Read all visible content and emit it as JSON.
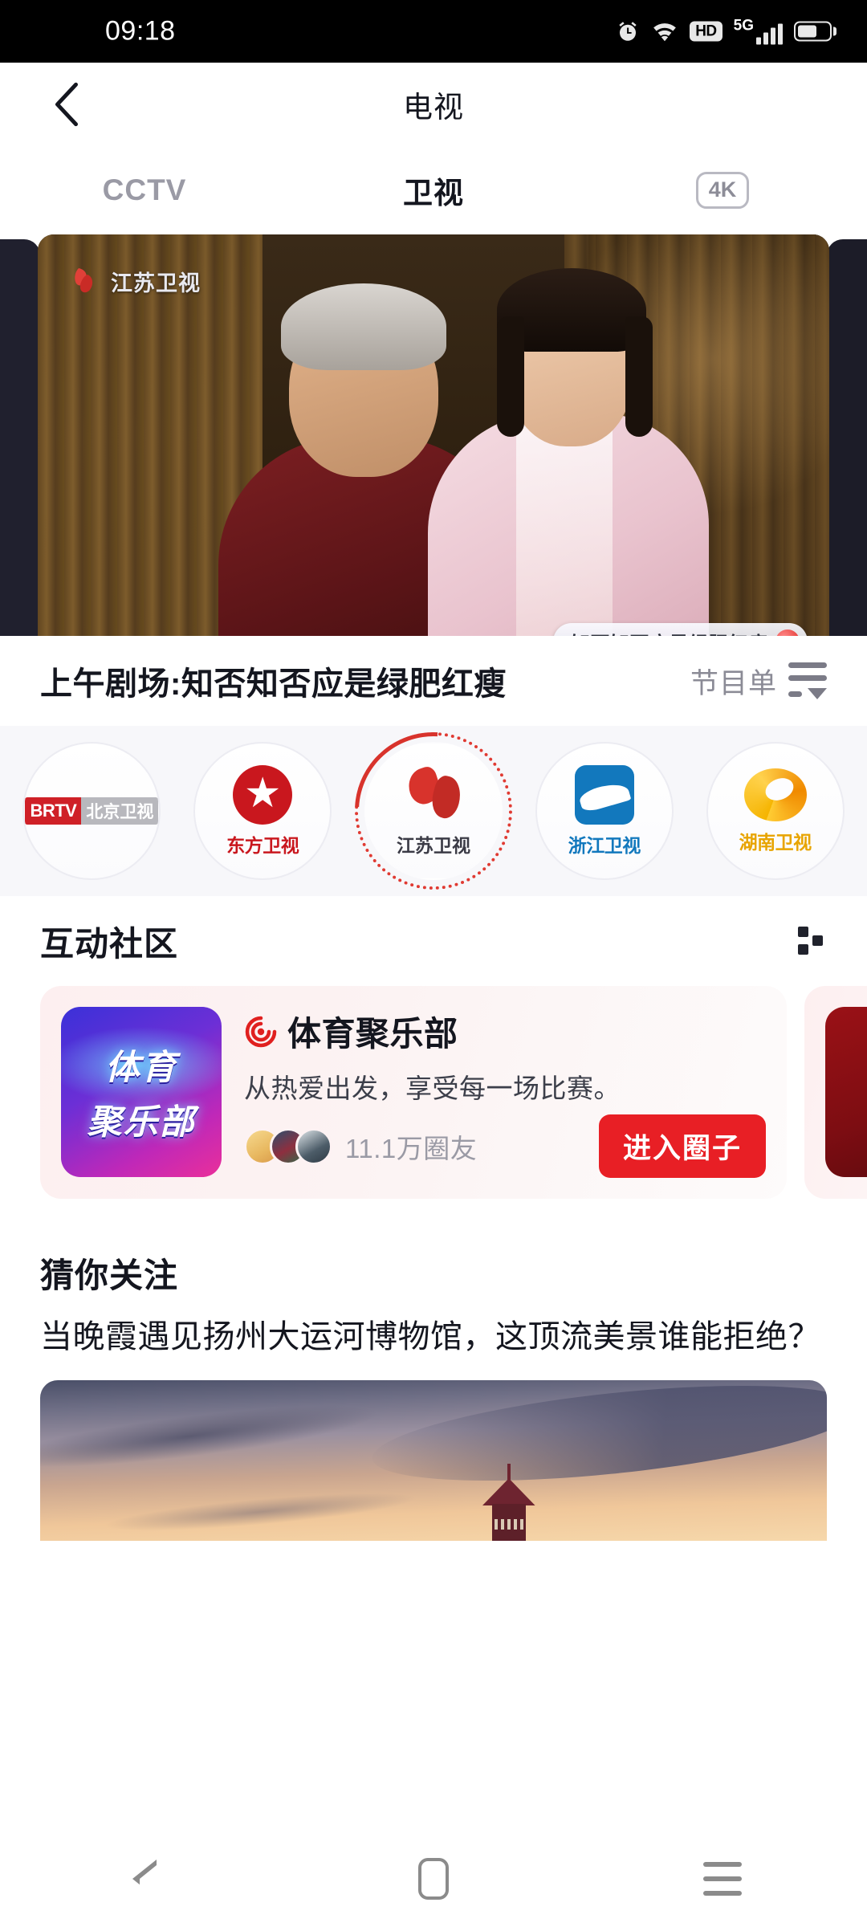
{
  "status_bar": {
    "time": "09:18",
    "icons": [
      "alarm-icon",
      "wifi-icon",
      "hd-icon",
      "5g-icon",
      "signal-icon",
      "battery-icon"
    ],
    "hd_label": "HD",
    "network_label": "5G"
  },
  "app_bar": {
    "back_icon": "chevron-left-icon",
    "title": "电视"
  },
  "tabs": [
    {
      "label": "CCTV",
      "active": false
    },
    {
      "label": "卫视",
      "active": true
    },
    {
      "label": "4K",
      "active": false,
      "badge": true
    }
  ],
  "player": {
    "watermark_text": "江苏卫视",
    "watermark_icon": "jiangsu-tv-logo",
    "badge_label": "知否知否应是绿肥红瘦"
  },
  "program": {
    "title": "上午剧场:知否知否应是绿肥红瘦",
    "list_label": "节目单",
    "list_icon": "program-list-icon"
  },
  "channels": [
    {
      "name": "北京卫视",
      "short": "BRTV",
      "sub": "北京卫视",
      "selected": false
    },
    {
      "name": "东方卫视",
      "selected": false
    },
    {
      "name": "江苏卫视",
      "selected": true
    },
    {
      "name": "浙江卫视",
      "selected": false
    },
    {
      "name": "湖南卫视",
      "selected": false
    }
  ],
  "community": {
    "section_title": "互动社区",
    "more_icon": "more-dots-icon",
    "cards": [
      {
        "thumb_line1": "体育",
        "thumb_line2": "聚乐部",
        "title": "体育聚乐部",
        "title_icon": "target-icon",
        "subtitle": "从热爱出发，享受每一场比赛。",
        "members": "11.1万圈友",
        "button": "进入圈子"
      }
    ]
  },
  "guess": {
    "section_title": "猜你关注",
    "headline": "当晚霞遇见扬州大运河博物馆，这顶流美景谁能拒绝？"
  },
  "nav_bar": {
    "back_icon": "nav-back-icon",
    "home_icon": "nav-home-icon",
    "recents_icon": "nav-recents-icon"
  },
  "colors": {
    "accent_red": "#e81f25",
    "selected_ring": "#d8332c",
    "text_primary": "#14161f",
    "text_muted": "#9a9aa5",
    "strip_bg": "#f7f7fa"
  }
}
